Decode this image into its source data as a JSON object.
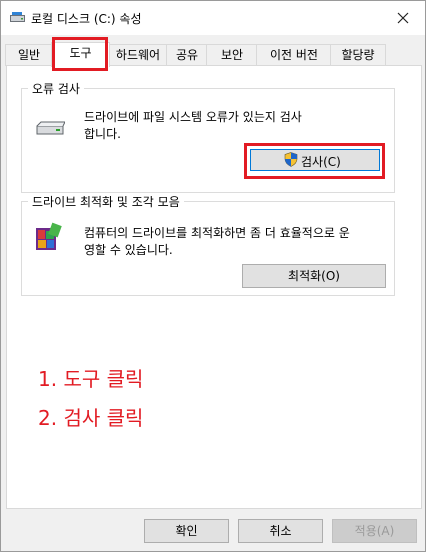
{
  "window": {
    "title": "로컬 디스크 (C:) 속성"
  },
  "tabs": [
    "일반",
    "도구",
    "하드웨어",
    "공유",
    "보안",
    "이전 버전",
    "할당량"
  ],
  "error_check": {
    "title": "오류 검사",
    "desc_line1": "드라이브에 파일 시스템 오류가 있는지 검사",
    "desc_line2": "합니다.",
    "button": "검사(C)"
  },
  "optimize": {
    "title": "드라이브 최적화 및 조각 모음",
    "desc_line1": "컴퓨터의 드라이브를 최적화하면 좀 더 효율적으로 운",
    "desc_line2": "영할 수 있습니다.",
    "button": "최적화(O)"
  },
  "instructions": [
    "1. 도구 클릭",
    "2. 검사 클릭"
  ],
  "footer": {
    "ok": "확인",
    "cancel": "취소",
    "apply": "적용(A)"
  },
  "colors": {
    "highlight": "#e21b23",
    "accent": "#0078d7"
  }
}
